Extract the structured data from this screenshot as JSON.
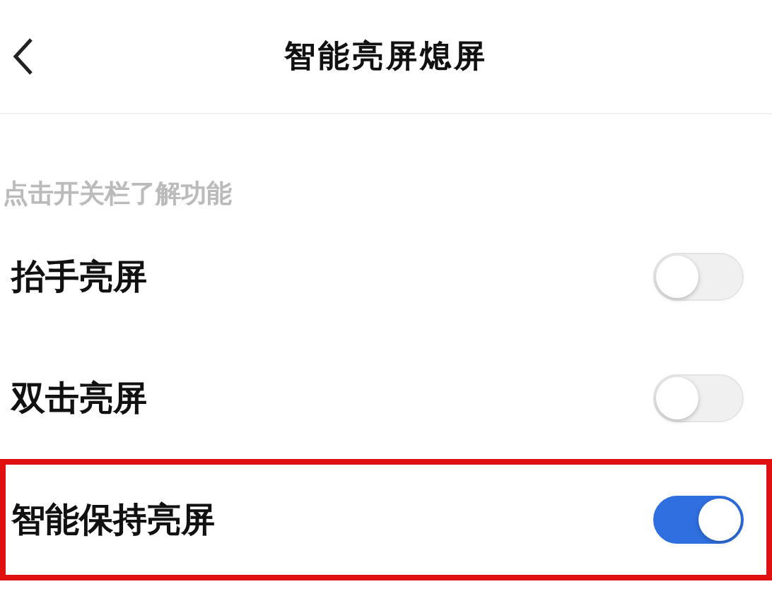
{
  "header": {
    "title": "智能亮屏熄屏"
  },
  "hint": "点击开关栏了解功能",
  "settings": [
    {
      "label": "抬手亮屏",
      "on": false,
      "highlighted": false
    },
    {
      "label": "双击亮屏",
      "on": false,
      "highlighted": false
    },
    {
      "label": "智能保持亮屏",
      "on": true,
      "highlighted": true
    }
  ]
}
